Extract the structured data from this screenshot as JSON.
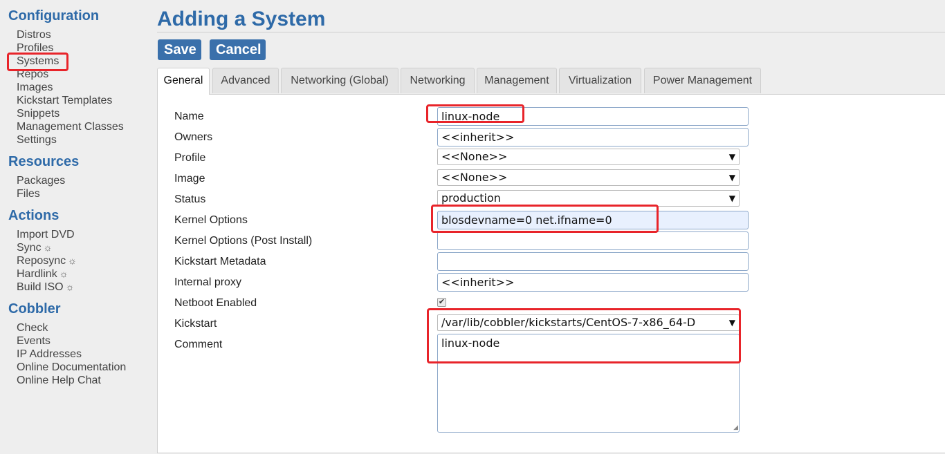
{
  "sidebar": {
    "sections": [
      {
        "title": "Configuration",
        "items": [
          {
            "label": "Distros"
          },
          {
            "label": "Profiles"
          },
          {
            "label": "Systems"
          },
          {
            "label": "Repos"
          },
          {
            "label": "Images"
          },
          {
            "label": "Kickstart Templates"
          },
          {
            "label": "Snippets"
          },
          {
            "label": "Management Classes"
          },
          {
            "label": "Settings"
          }
        ]
      },
      {
        "title": "Resources",
        "items": [
          {
            "label": "Packages"
          },
          {
            "label": "Files"
          }
        ]
      },
      {
        "title": "Actions",
        "items": [
          {
            "label": "Import DVD"
          },
          {
            "label": "Sync",
            "icon": "gear-icon"
          },
          {
            "label": "Reposync",
            "icon": "gear-icon"
          },
          {
            "label": "Hardlink",
            "icon": "gear-icon"
          },
          {
            "label": "Build ISO",
            "icon": "gear-icon"
          }
        ]
      },
      {
        "title": "Cobbler",
        "items": [
          {
            "label": "Check"
          },
          {
            "label": "Events"
          },
          {
            "label": "IP Addresses"
          },
          {
            "label": "Online Documentation"
          },
          {
            "label": "Online Help Chat"
          }
        ]
      }
    ],
    "gear_glyph": "☼"
  },
  "page": {
    "title": "Adding a System",
    "save_label": "Save",
    "cancel_label": "Cancel"
  },
  "tabs": [
    {
      "label": "General",
      "active": true
    },
    {
      "label": "Advanced"
    },
    {
      "label": "Networking (Global)"
    },
    {
      "label": "Networking"
    },
    {
      "label": "Management"
    },
    {
      "label": "Virtualization"
    },
    {
      "label": "Power Management"
    }
  ],
  "form": {
    "name": {
      "label": "Name",
      "value": "linux-node"
    },
    "owners": {
      "label": "Owners",
      "value": "<<inherit>>"
    },
    "profile": {
      "label": "Profile",
      "value": "<<None>>"
    },
    "image": {
      "label": "Image",
      "value": "<<None>>"
    },
    "status": {
      "label": "Status",
      "value": "production"
    },
    "kernel_options": {
      "label": "Kernel Options",
      "value": "blosdevname=0 net.ifname=0"
    },
    "kernel_options_post": {
      "label": "Kernel Options (Post Install)",
      "value": ""
    },
    "kickstart_metadata": {
      "label": "Kickstart Metadata",
      "value": ""
    },
    "internal_proxy": {
      "label": "Internal proxy",
      "value": "<<inherit>>"
    },
    "netboot_enabled": {
      "label": "Netboot Enabled",
      "checked": true,
      "check_glyph": "✔"
    },
    "kickstart": {
      "label": "Kickstart",
      "value": "/var/lib/cobbler/kickstarts/CentOS-7-x86_64-D"
    },
    "comment": {
      "label": "Comment",
      "value": "linux-node"
    },
    "select_arrow": "▼"
  },
  "colors": {
    "accent": "#2e6aa8",
    "button": "#3a70ab",
    "highlight": "#e8242a"
  }
}
